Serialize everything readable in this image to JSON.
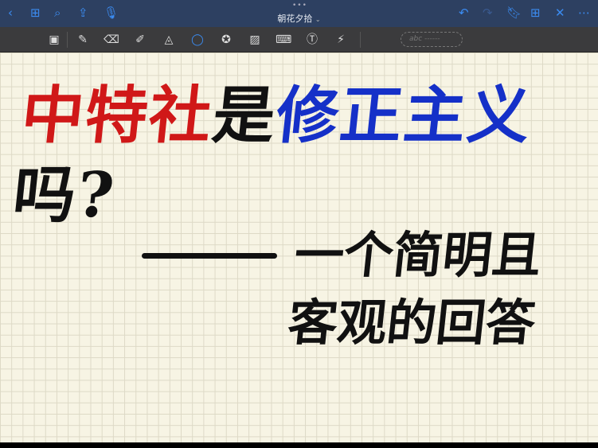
{
  "header": {
    "title": "朝花夕拾",
    "title_caret": "⌄",
    "more_dots": "•••"
  },
  "toolbar": {
    "placeholder_text": "abc"
  },
  "note": {
    "line1": [
      {
        "text": "中特社",
        "color": "red"
      },
      {
        "text": "是",
        "color": "black"
      },
      {
        "text": "修正主义",
        "color": "blue"
      },
      {
        "text": "吗?",
        "color": "black"
      }
    ],
    "line2": "一个简明且",
    "line3": "客观的回答"
  },
  "colors": {
    "header": "#2d4061",
    "accent": "#3b8bf0",
    "toolbar": "#3b3b3d",
    "paper": "#f7f4e4",
    "red": "#d01818",
    "blue": "#1530c8"
  }
}
